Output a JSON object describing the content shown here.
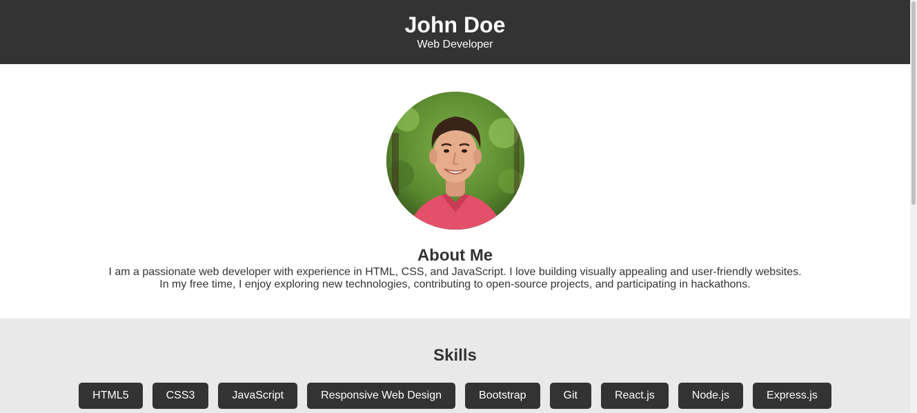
{
  "header": {
    "name": "John Doe",
    "role": "Web Developer"
  },
  "about": {
    "avatar_alt": "Profile photo",
    "heading": "About Me",
    "line1": "I am a passionate web developer with experience in HTML, CSS, and JavaScript. I love building visually appealing and user-friendly websites.",
    "line2": "In my free time, I enjoy exploring new technologies, contributing to open-source projects, and participating in hackathons."
  },
  "skills": {
    "heading": "Skills",
    "items": [
      "HTML5",
      "CSS3",
      "JavaScript",
      "Responsive Web Design",
      "Bootstrap",
      "Git",
      "React.js",
      "Node.js",
      "Express.js"
    ]
  },
  "colors": {
    "header_bg": "#333333",
    "skills_bg": "#e9e9e9",
    "skill_badge_bg": "#333333"
  }
}
